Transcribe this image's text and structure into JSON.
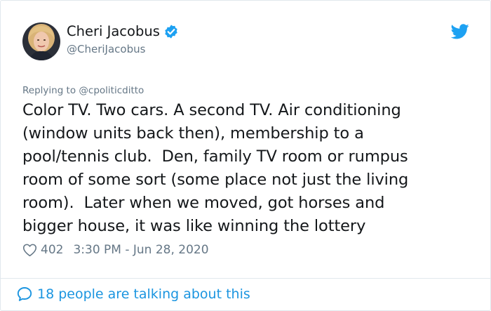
{
  "author": {
    "display_name": "Cheri Jacobus",
    "handle": "@CheriJacobus",
    "verified": true
  },
  "reply": {
    "text": "Replying to @cpoliticditto"
  },
  "tweet": {
    "text": "Color TV. Two cars. A second TV. Air conditioning\n(window units back then), membership to a\npool/tennis club.  Den, family TV room or rumpus\nroom of some sort (some place not just the living\nroom).  Later when we moved, got horses and\nbigger house, it was like winning the lottery",
    "likes": "402",
    "timestamp": "3:30 PM - Jun 28, 2020"
  },
  "footer": {
    "talking_text": "18 people are talking about this"
  },
  "colors": {
    "link_blue": "#1b95e0",
    "verified_blue": "#1da1f2",
    "muted_gray": "#657786",
    "text_dark": "#14171a"
  },
  "icons": [
    "verified-badge-icon",
    "twitter-bird-icon",
    "heart-icon",
    "speech-bubble-icon"
  ]
}
